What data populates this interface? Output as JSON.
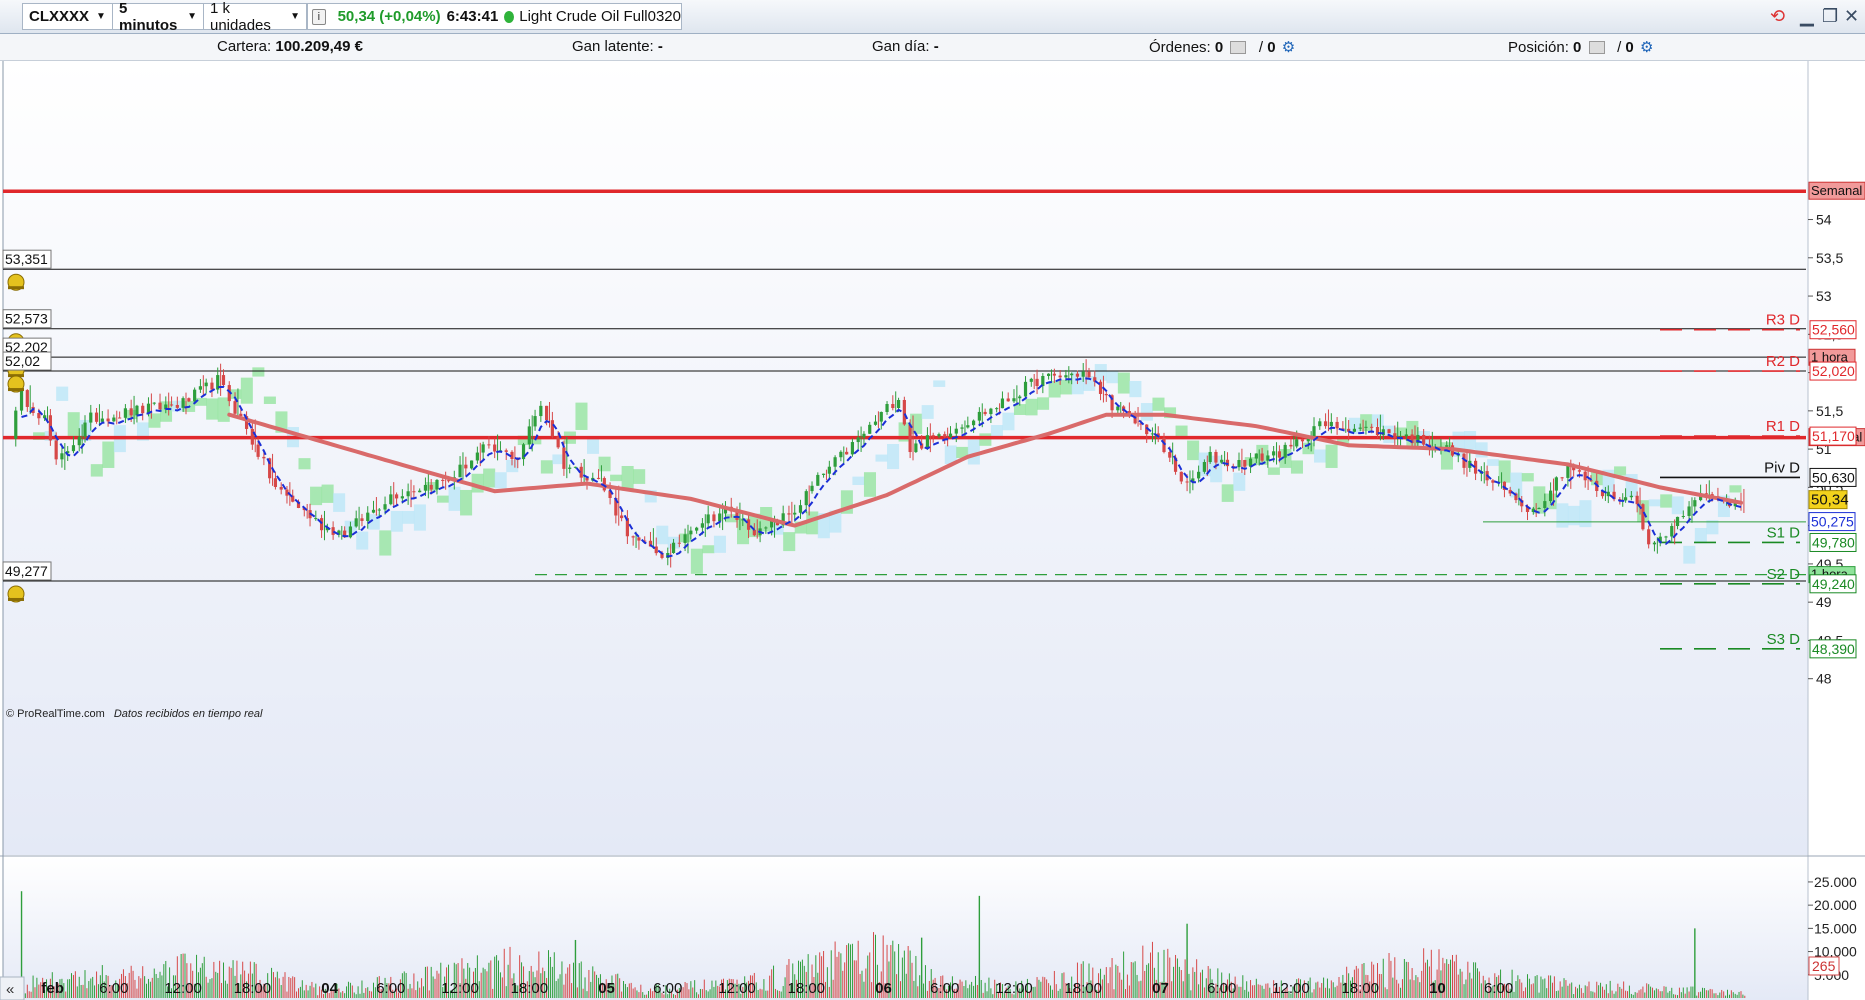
{
  "toolbar": {
    "symbol": "CLXXXX",
    "timeframe": "5 minutos",
    "units": "1 k unidades",
    "price_change": "50,34 (+0,04%)",
    "time": "6:43:41",
    "instrument": "Light Crude Oil Full0320",
    "info_icon": "info-icon",
    "status_icon": "green-dot-icon"
  },
  "portfolio": {
    "cartera_label": "Cartera:",
    "cartera_value": "100.209,49 €",
    "gan_latente_label": "Gan latente:",
    "gan_latente_value": "-",
    "gan_dia_label": "Gan día:",
    "gan_dia_value": "-",
    "ordenes_label": "Órdenes:",
    "ordenes_a": "0",
    "ordenes_sep": "/",
    "ordenes_b": "0",
    "posicion_label": "Posición:",
    "posicion_a": "0",
    "posicion_sep": "/",
    "posicion_b": "0"
  },
  "footer": {
    "credit": "© ProRealTime.com",
    "realtime": "Datos recibidos en tiempo real",
    "collapse_icon": "double-chevron-left-icon"
  },
  "colors": {
    "red_line": "#e0282c",
    "ma_line": "#d96a6a",
    "kijun": "#1b2fd6",
    "cloud_green": "#8fe39a",
    "cloud_blue": "#b8e6f7",
    "pivot_green": "#1a8a24",
    "alert_bell": "#e4c21e",
    "price_tag": "#f3d21c"
  },
  "chart_data": {
    "type": "line",
    "title": "",
    "price_axis": {
      "min": 47.8,
      "max": 55.0,
      "ticks": [
        "54",
        "53,5",
        "53",
        "52,5",
        "52",
        "51,5",
        "51",
        "50,5",
        "50",
        "49,5",
        "49",
        "48,5",
        "48"
      ],
      "tick_values": [
        54,
        53.5,
        53,
        52.5,
        52,
        51.5,
        51,
        50.5,
        50,
        49.5,
        49,
        48.5,
        48
      ]
    },
    "volume_axis": {
      "max": 28000,
      "ticks": [
        "25.000",
        "20.000",
        "15.000",
        "10.000",
        "5.000"
      ],
      "tick_values": [
        25000,
        20000,
        15000,
        10000,
        5000
      ],
      "last_volume": "265"
    },
    "time_axis": {
      "labels": [
        "feb",
        "6:00",
        "12:00",
        "18:00",
        "04",
        "6:00",
        "12:00",
        "18:00",
        "05",
        "6:00",
        "12:00",
        "18:00",
        "06",
        "6:00",
        "12:00",
        "18:00",
        "07",
        "6:00",
        "12:00",
        "18:00",
        "10",
        "6:00"
      ],
      "bold": [
        true,
        false,
        false,
        false,
        true,
        false,
        false,
        false,
        true,
        false,
        false,
        false,
        true,
        false,
        false,
        false,
        true,
        false,
        false,
        false,
        true,
        false
      ],
      "bar_index": [
        6,
        18,
        30,
        42,
        54,
        66,
        78,
        90,
        102,
        114,
        126,
        138,
        150,
        162,
        174,
        186,
        198,
        210,
        222,
        234,
        246,
        258
      ]
    },
    "alert_lines": [
      {
        "label": "53,351",
        "value": 53.351
      },
      {
        "label": "52,573",
        "value": 52.573
      },
      {
        "label": "52,202",
        "value": 52.202
      },
      {
        "label": "52,02",
        "value": 52.02
      },
      {
        "label": "49,277",
        "value": 49.277
      }
    ],
    "weekly_levels": [
      {
        "label": "Semanal",
        "value": 54.37
      },
      {
        "label": "Semanal",
        "value": 51.15
      }
    ],
    "hourly_levels": [
      {
        "label": "1 hora",
        "value": 52.2
      },
      {
        "label": "1 hora",
        "value": 50.05
      },
      {
        "label": "1 hora",
        "value": 49.36
      }
    ],
    "pivots": [
      {
        "name": "R3 D",
        "value": 52.56,
        "label": "52,560",
        "color": "red"
      },
      {
        "name": "R2 D",
        "value": 52.02,
        "label": "52,020",
        "color": "red"
      },
      {
        "name": "R1 D",
        "value": 51.17,
        "label": "51,170",
        "color": "red"
      },
      {
        "name": "Piv D",
        "value": 50.63,
        "label": "50,630",
        "color": "black"
      },
      {
        "name": "S1 D",
        "value": 49.78,
        "label": "49,780",
        "color": "green"
      },
      {
        "name": "S2 D",
        "value": 49.24,
        "label": "49,240",
        "color": "green"
      },
      {
        "name": "S3 D",
        "value": 48.39,
        "label": "48,390",
        "color": "green"
      }
    ],
    "last_price": {
      "label": "50,34",
      "value": 50.34
    },
    "kijun_last": {
      "label": "50,275",
      "value": 50.275
    },
    "close_keypoints": [
      [
        0,
        51.2
      ],
      [
        2,
        51.7
      ],
      [
        6,
        51.4
      ],
      [
        8,
        50.8
      ],
      [
        14,
        51.4
      ],
      [
        22,
        51.5
      ],
      [
        30,
        51.6
      ],
      [
        36,
        51.9
      ],
      [
        40,
        51.4
      ],
      [
        46,
        50.5
      ],
      [
        54,
        50.0
      ],
      [
        58,
        49.9
      ],
      [
        66,
        50.4
      ],
      [
        76,
        50.6
      ],
      [
        82,
        51.0
      ],
      [
        88,
        50.9
      ],
      [
        92,
        51.6
      ],
      [
        96,
        50.8
      ],
      [
        102,
        50.6
      ],
      [
        108,
        49.8
      ],
      [
        114,
        49.6
      ],
      [
        118,
        50.0
      ],
      [
        124,
        50.2
      ],
      [
        130,
        49.9
      ],
      [
        136,
        50.2
      ],
      [
        140,
        50.6
      ],
      [
        148,
        51.2
      ],
      [
        154,
        51.7
      ],
      [
        156,
        51.0
      ],
      [
        164,
        51.3
      ],
      [
        172,
        51.6
      ],
      [
        178,
        51.9
      ],
      [
        186,
        52.0
      ],
      [
        192,
        51.5
      ],
      [
        198,
        51.2
      ],
      [
        204,
        50.5
      ],
      [
        208,
        50.9
      ],
      [
        212,
        50.8
      ],
      [
        222,
        51.0
      ],
      [
        226,
        51.3
      ],
      [
        232,
        51.3
      ],
      [
        240,
        51.2
      ],
      [
        248,
        51.05
      ],
      [
        258,
        50.5
      ],
      [
        264,
        50.2
      ],
      [
        270,
        50.8
      ],
      [
        276,
        50.4
      ],
      [
        282,
        50.35
      ],
      [
        284,
        49.7
      ],
      [
        288,
        50.0
      ],
      [
        292,
        50.4
      ],
      [
        298,
        50.3
      ],
      [
        300,
        50.34
      ]
    ],
    "ma_keypoints": [
      [
        38,
        51.45
      ],
      [
        54,
        51.1
      ],
      [
        70,
        50.75
      ],
      [
        84,
        50.45
      ],
      [
        100,
        50.55
      ],
      [
        118,
        50.35
      ],
      [
        136,
        50.0
      ],
      [
        152,
        50.4
      ],
      [
        166,
        50.9
      ],
      [
        180,
        51.2
      ],
      [
        190,
        51.45
      ],
      [
        200,
        51.45
      ],
      [
        216,
        51.3
      ],
      [
        232,
        51.05
      ],
      [
        250,
        51.0
      ],
      [
        270,
        50.8
      ],
      [
        286,
        50.5
      ],
      [
        300,
        50.3
      ]
    ],
    "volume_keypoints": [
      [
        0,
        4000
      ],
      [
        30,
        9000
      ],
      [
        42,
        7500
      ],
      [
        54,
        2500
      ],
      [
        90,
        11000
      ],
      [
        102,
        6000
      ],
      [
        110,
        3000
      ],
      [
        126,
        4000
      ],
      [
        138,
        9000
      ],
      [
        150,
        14000
      ],
      [
        162,
        5000
      ],
      [
        174,
        3500
      ],
      [
        186,
        7500
      ],
      [
        198,
        11000
      ],
      [
        210,
        5500
      ],
      [
        222,
        3500
      ],
      [
        234,
        8000
      ],
      [
        246,
        10000
      ],
      [
        258,
        6000
      ],
      [
        270,
        4000
      ],
      [
        300,
        1500
      ]
    ],
    "grid": false,
    "legend": "none"
  }
}
